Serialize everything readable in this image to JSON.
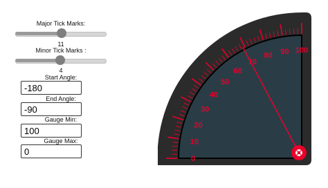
{
  "controls": {
    "major_ticks": {
      "label": "Major Tick Marks:",
      "value": "11",
      "fraction": 0.51
    },
    "minor_ticks": {
      "label": "Minor Tick Marks :",
      "value": "4",
      "fraction": 0.49
    },
    "start_angle": {
      "label": "Start Angle:",
      "value": "-180"
    },
    "end_angle": {
      "label": "End Angle:",
      "value": "-90"
    },
    "gauge_min": {
      "label": "Gauge Min:",
      "value": "100"
    },
    "gauge_max": {
      "label": "Gauge Max:",
      "value": "0"
    }
  },
  "gauge": {
    "scale_min": 0,
    "scale_max": 100,
    "major_step": 10,
    "minor_per_major": 4,
    "needle_value": 69,
    "colors": {
      "bezel": "#2b2b2b",
      "face": "#2a3d47",
      "accent": "#e8002a",
      "hub": "#e8002a"
    },
    "hub_icon": "gear-icon"
  }
}
